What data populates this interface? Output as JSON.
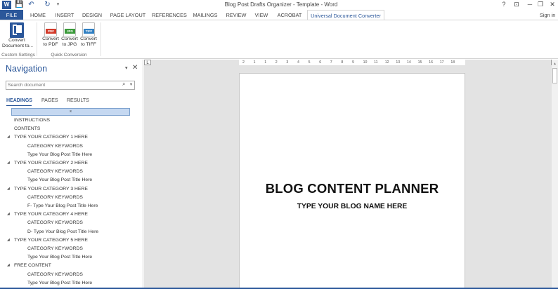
{
  "window": {
    "title": "Blog Post Drafts Organizer - Template - Word",
    "quick_access": [
      "W",
      "💾",
      "↶",
      "↻",
      "▾"
    ],
    "controls": [
      "?",
      "⊡",
      "─",
      "❐",
      "✕"
    ]
  },
  "ribbon": {
    "tabs": [
      "FILE",
      "HOME",
      "INSERT",
      "DESIGN",
      "PAGE LAYOUT",
      "REFERENCES",
      "MAILINGS",
      "REVIEW",
      "VIEW",
      "ACROBAT",
      "Universal Document Converter"
    ],
    "signin": "Sign in",
    "buttons": [
      {
        "line1": "Convert",
        "line2": "Document to...",
        "icon": "convert-document-icon"
      },
      {
        "line1": "Convert",
        "line2": "to PDF",
        "icon": "pdf-icon",
        "badge": "PDF"
      },
      {
        "line1": "Convert",
        "line2": "to JPG",
        "icon": "jpg-icon",
        "badge": "JPG"
      },
      {
        "line1": "Convert",
        "line2": "to TIFF",
        "icon": "tiff-icon",
        "badge": "TIFF"
      }
    ],
    "groups": [
      "Custom Settings",
      "Quick Conversion"
    ]
  },
  "navigation": {
    "title": "Navigation",
    "search_placeholder": "Search document",
    "tabs": [
      "HEADINGS",
      "PAGES",
      "RESULTS"
    ],
    "collapse_glyph": "⌅",
    "items": [
      {
        "text": "INSTRUCTIONS",
        "level": 1,
        "expand": false
      },
      {
        "text": "CONTENTS",
        "level": 1,
        "expand": false
      },
      {
        "text": "TYPE YOUR CATEGORY 1 HERE",
        "level": 1,
        "expand": true
      },
      {
        "text": "CATEGORY KEYWORDS",
        "level": 2,
        "expand": false
      },
      {
        "text": "Type Your Blog Post Title Here",
        "level": 2,
        "expand": false
      },
      {
        "text": "TYPE YOUR CATEGORY 2 HERE",
        "level": 1,
        "expand": true
      },
      {
        "text": "CATEGORY KEYWORDS",
        "level": 2,
        "expand": false
      },
      {
        "text": "Type Your Blog Post Title Here",
        "level": 2,
        "expand": false
      },
      {
        "text": "TYPE YOUR CATEGORY 3 HERE",
        "level": 1,
        "expand": true
      },
      {
        "text": "CATEGORY KEYWORDS",
        "level": 2,
        "expand": false
      },
      {
        "text": "F- Type Your Blog Post Title Here",
        "level": 2,
        "expand": false
      },
      {
        "text": "TYPE YOUR CATEGORY 4 HERE",
        "level": 1,
        "expand": true
      },
      {
        "text": "CATEGORY KEYWORDS",
        "level": 2,
        "expand": false
      },
      {
        "text": "D- Type Your Blog Post Title Here",
        "level": 2,
        "expand": false
      },
      {
        "text": "TYPE YOUR CATEGORY 5 HERE",
        "level": 1,
        "expand": true
      },
      {
        "text": "CATEGORY KEYWORDS",
        "level": 2,
        "expand": false
      },
      {
        "text": "Type Your Blog Post Title Here",
        "level": 2,
        "expand": false
      },
      {
        "text": "FREE CONTENT",
        "level": 1,
        "expand": true
      },
      {
        "text": "CATEGORY KEYWORDS",
        "level": 2,
        "expand": false
      },
      {
        "text": "Type Your Blog Post Title Here",
        "level": 2,
        "expand": false
      }
    ]
  },
  "ruler": {
    "ticks": [
      "2",
      "1",
      "1",
      "2",
      "3",
      "4",
      "5",
      "6",
      "7",
      "8",
      "9",
      "10",
      "11",
      "12",
      "13",
      "14",
      "15",
      "16",
      "17",
      "18"
    ],
    "left_marker": "L"
  },
  "document": {
    "heading": "BLOG CONTENT PLANNER",
    "subheading": "TYPE YOUR BLOG NAME HERE"
  },
  "colors": {
    "accent": "#2b579a",
    "nav_selected": "#c5d8f1",
    "doc_background": "#e3e3e3"
  }
}
